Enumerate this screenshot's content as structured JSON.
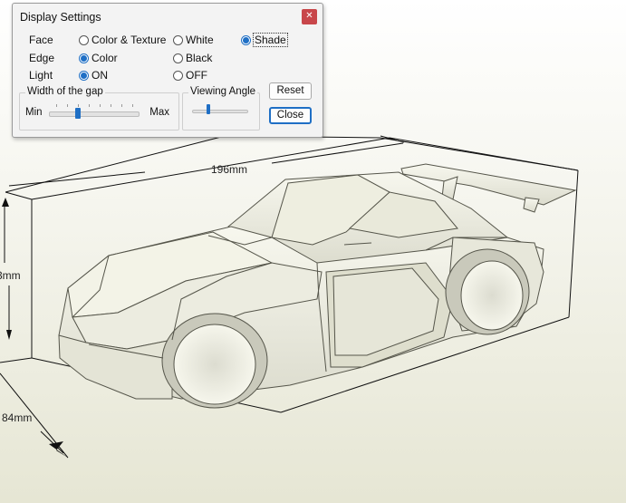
{
  "dialog": {
    "title": "Display Settings",
    "close_icon": "close-icon",
    "rows": {
      "face": {
        "label": "Face",
        "options": [
          "Color & Texture",
          "White",
          "Shade"
        ],
        "selected": "Shade"
      },
      "edge": {
        "label": "Edge",
        "options": [
          "Color",
          "Black"
        ],
        "selected": "Color"
      },
      "light": {
        "label": "Light",
        "options": [
          "ON",
          "OFF"
        ],
        "selected": "ON"
      }
    },
    "gap": {
      "title": "Width of the gap",
      "min_label": "Min",
      "max_label": "Max",
      "value_fraction": 0.33
    },
    "angle": {
      "title": "Viewing Angle",
      "value_fraction": 0.3
    },
    "reset_label": "Reset",
    "close_label": "Close"
  },
  "viewport": {
    "dimensions": {
      "length": "196mm",
      "height_partial": "3mm",
      "width": "84mm"
    },
    "model_color": "#efefe2",
    "edge_color": "#55554a"
  }
}
